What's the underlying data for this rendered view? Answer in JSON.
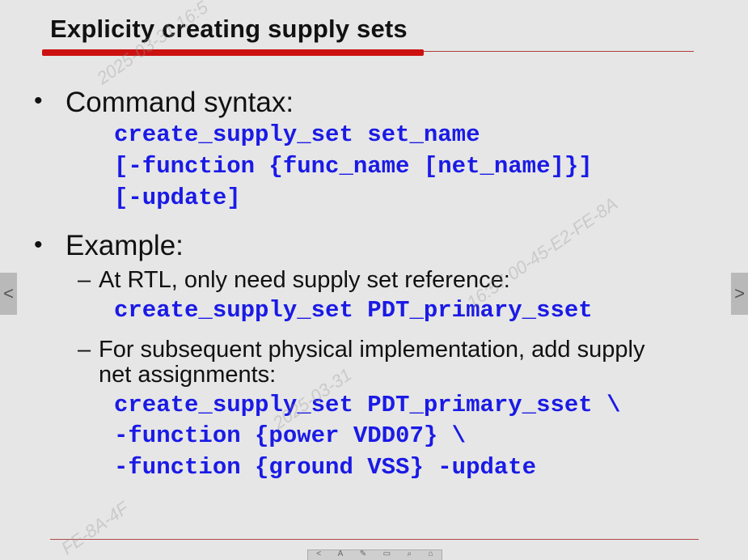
{
  "title": "Explicity creating supply sets",
  "bullets": {
    "b1": "Command syntax:",
    "b1_code": [
      "create_supply_set set_name",
      "[-function {func_name [net_name]}]",
      "[-update]"
    ],
    "b2": "Example:",
    "s1": "At RTL, only need supply set reference:",
    "s1_code": [
      "create_supply_set PDT_primary_sset"
    ],
    "s2_line1": "For subsequent physical implementation, add supply",
    "s2_line2": "net assignments:",
    "s2_code": [
      "create_supply_set PDT_primary_sset \\",
      "-function {power VDD07} \\",
      "-function {ground VSS} -update"
    ]
  },
  "nav": {
    "prev": "<",
    "next": ">"
  },
  "toolbar": [
    "<",
    "A",
    "✎",
    "▭",
    "⌕",
    "⌂"
  ],
  "watermarks": [
    "2025-03-31 16:5",
    "16:57 00-45-E2-FE-8A",
    "2025-03-31",
    "FE-8A-4F"
  ]
}
